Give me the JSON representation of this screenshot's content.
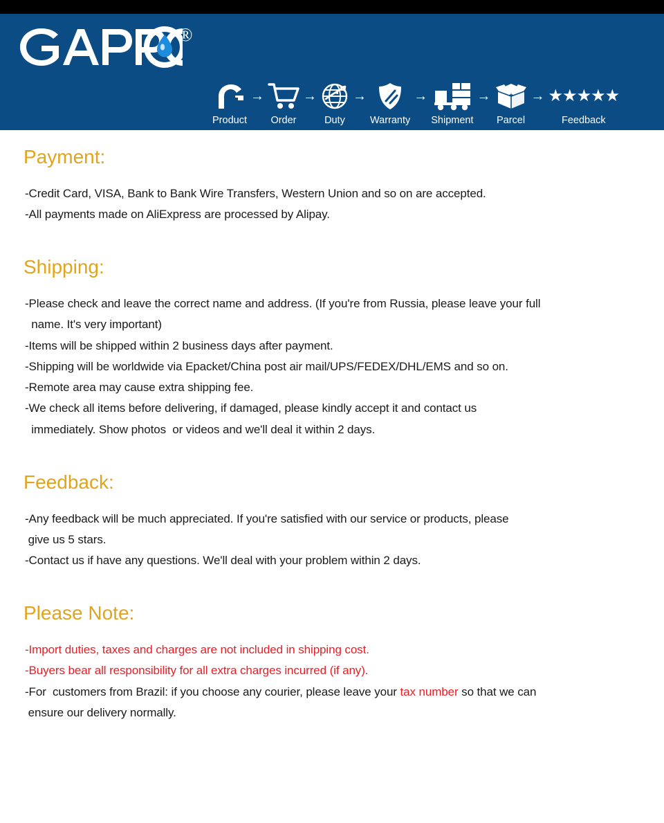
{
  "brand": {
    "name": "GAPPO",
    "registered_mark": "®",
    "banner_color": "#0b4c85",
    "topbar_color": "#000000",
    "logo_drop_color": "#1b8ddc"
  },
  "process_steps": [
    {
      "icon": "faucet-icon",
      "label": "Product"
    },
    {
      "icon": "cart-icon",
      "label": "Order"
    },
    {
      "icon": "globe-icon",
      "label": "Duty"
    },
    {
      "icon": "shield-icon",
      "label": "Warranty"
    },
    {
      "icon": "truck-icon",
      "label": "Shipment"
    },
    {
      "icon": "open-box-icon",
      "label": "Parcel"
    },
    {
      "icon": "stars-icon",
      "label": "Feedback",
      "stars": "★★★★★",
      "star_count": 5
    }
  ],
  "step_arrow": "→",
  "faint_banner_text": " ",
  "heading_color": "#e0a41d",
  "note_red_color": "#ec1c24",
  "sections": [
    {
      "id": "payment",
      "heading": "Payment:",
      "lines": [
        "-Credit Card, VISA, Bank to Bank Wire Transfers, Western Union and so on are accepted.",
        "-All payments made on AliExpress are processed by Alipay."
      ]
    },
    {
      "id": "shipping",
      "heading": "Shipping:",
      "lines": [
        "-Please check and leave the correct name and address. (If you're from Russia, please leave your full\n  name. It's very important)",
        "-Items will be shipped within 2 business days after payment.",
        "-Shipping will be worldwide via Epacket/China post air mail/UPS/FEDEX/DHL/EMS and so on.",
        "-Remote area may cause extra shipping fee.",
        "-We check all items before delivering, if damaged, please kindly accept it and contact us\n  immediately. Show photos  or videos and we'll deal it within 2 days."
      ]
    },
    {
      "id": "feedback",
      "heading": "Feedback:",
      "lines": [
        "-Any feedback will be much appreciated. If you're satisfied with our service or products, please\n give us 5 stars.",
        "-Contact us if have any questions. We'll deal with your problem within 2 days."
      ]
    },
    {
      "id": "please-note",
      "heading": "Please Note:",
      "lines_note": [
        {
          "text": "-Import duties, taxes and charges are not included in shipping cost.",
          "color": "red"
        },
        {
          "text": "-Buyers bear all responsibility for all extra charges incurred (if any).",
          "color": "red"
        },
        {
          "text_before": "-For  customers from Brazil: if you choose any courier, please leave your ",
          "highlight": "tax number",
          "text_after": " so that we can\n ensure our delivery normally.",
          "color": "mixed"
        }
      ]
    }
  ]
}
